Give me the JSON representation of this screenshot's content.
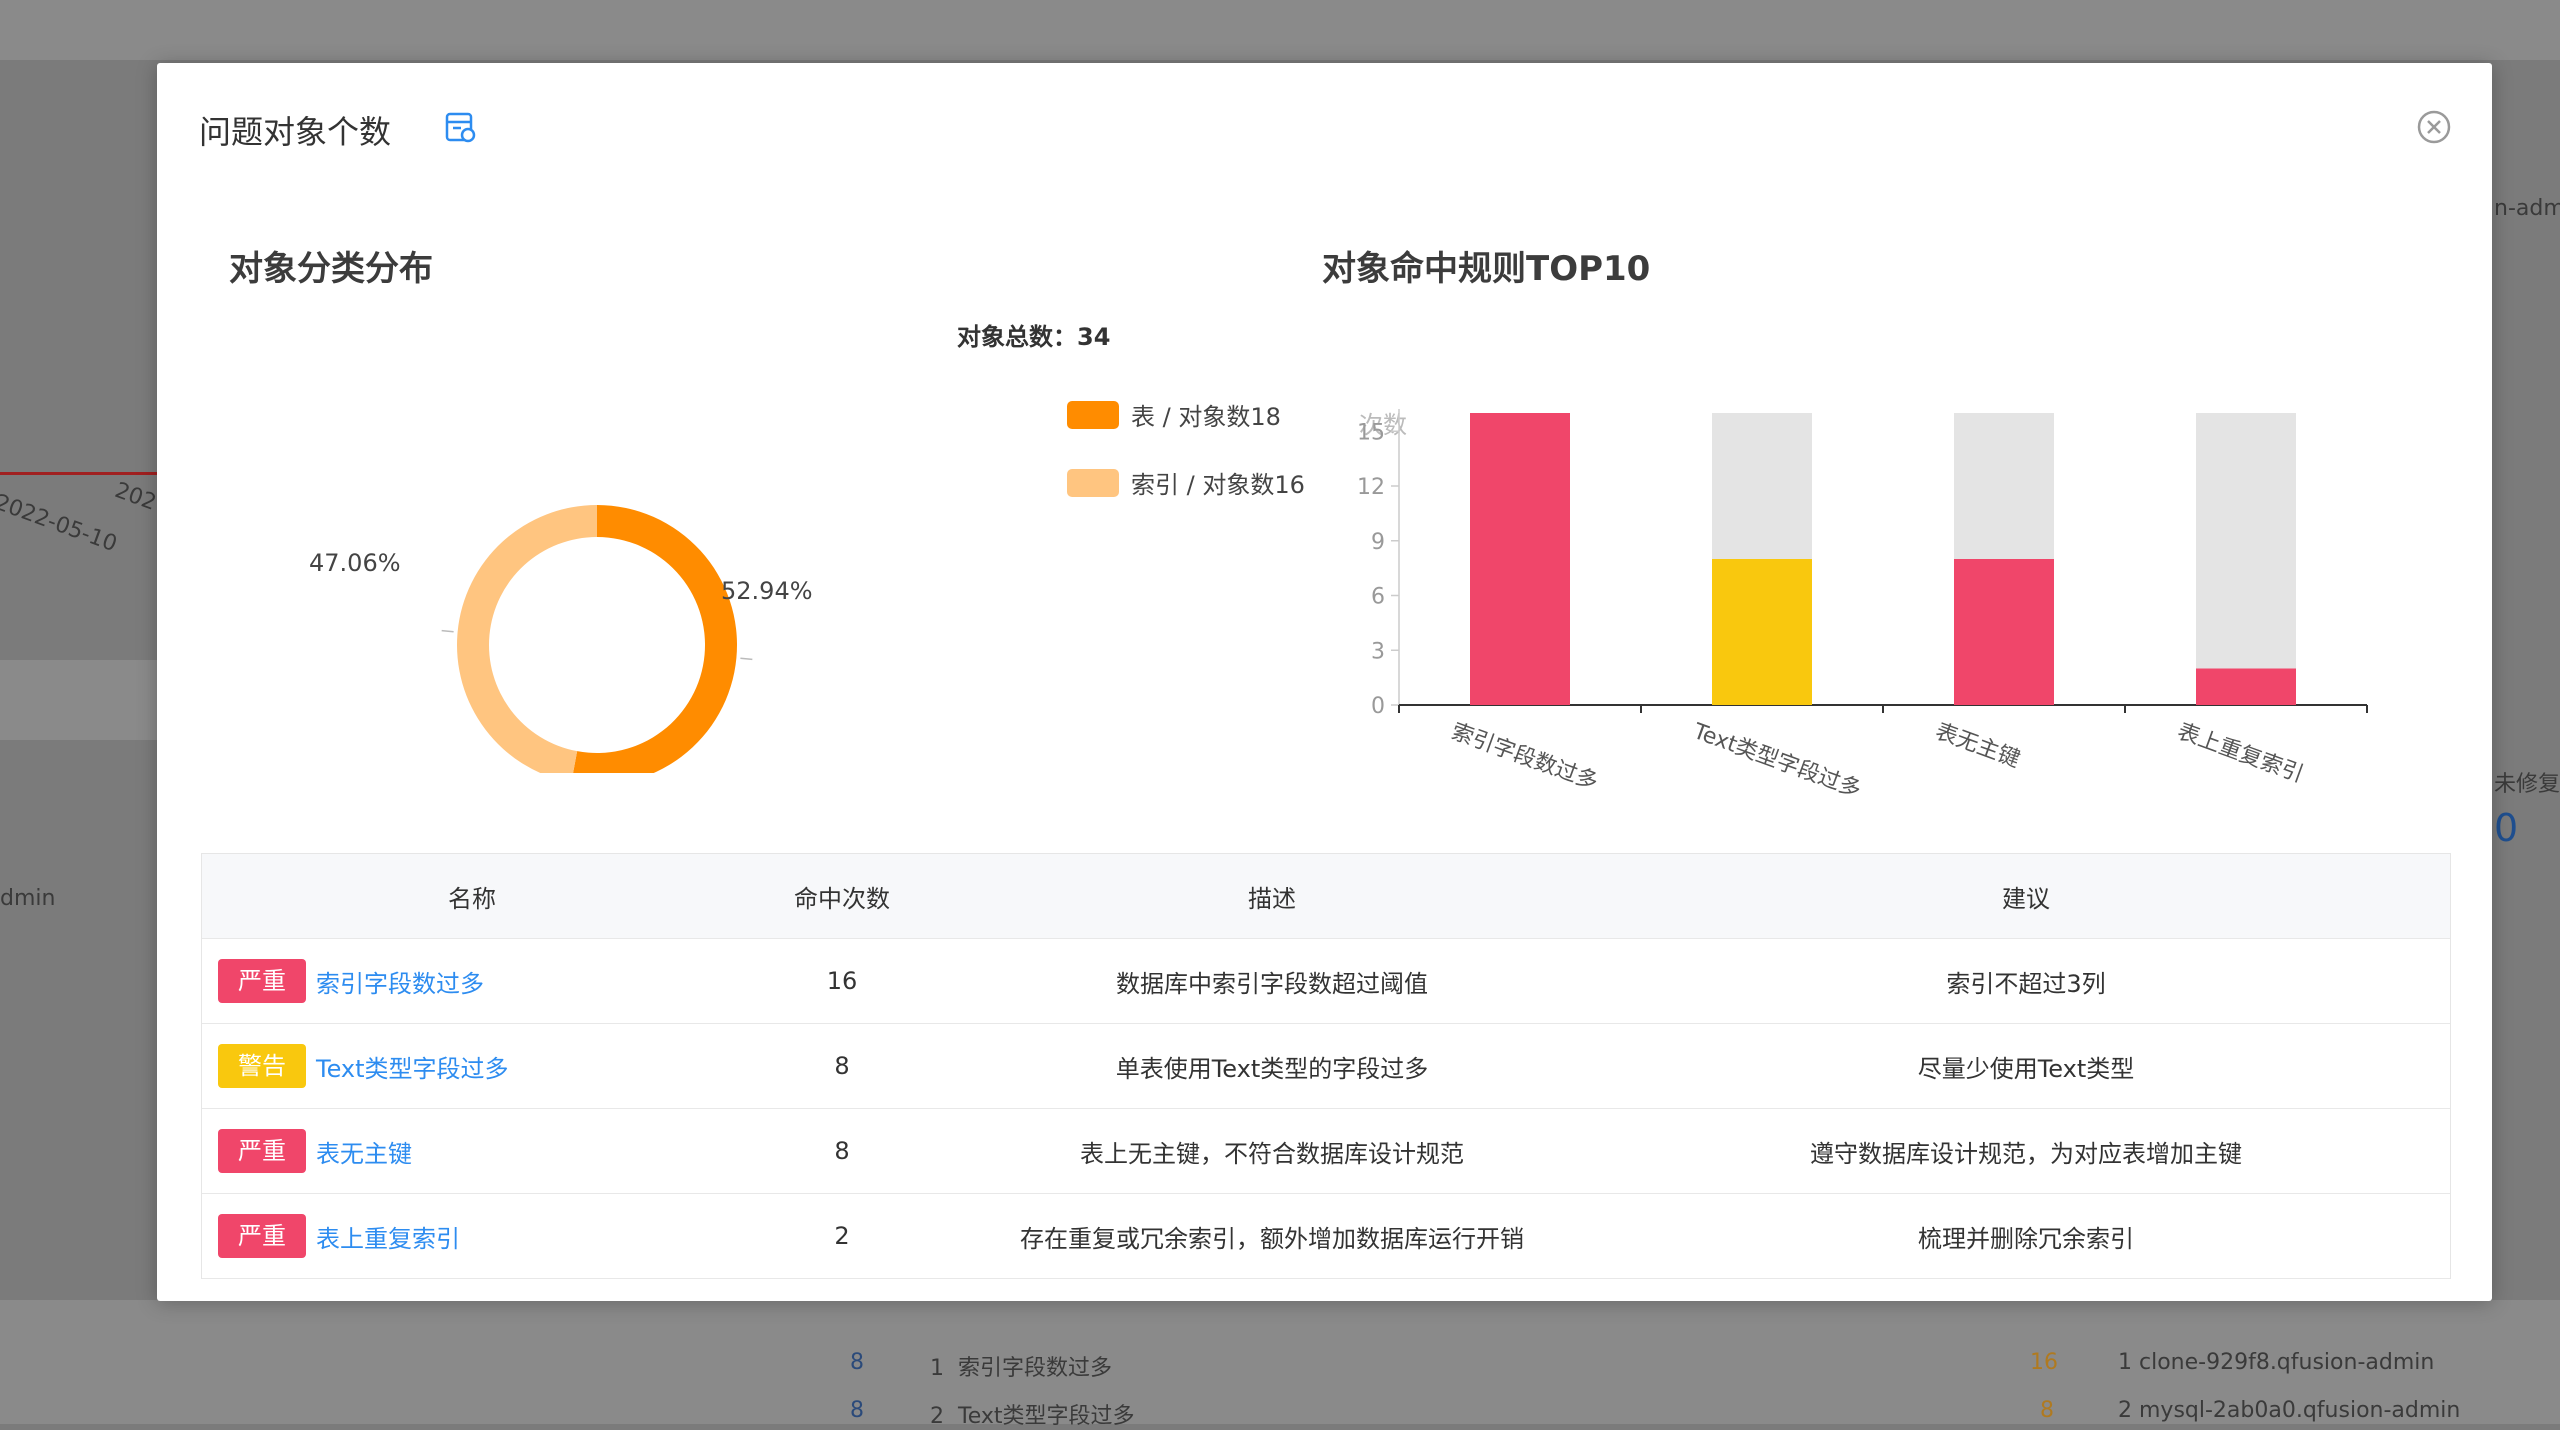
{
  "background": {
    "date_label": "2022-05-10",
    "date_label_2": "202",
    "admin_left": "dmin",
    "admin_right": "n-adm",
    "unfixed_label": "未修复",
    "unfixed_count": "0",
    "list_left": [
      {
        "rank": "1",
        "name": "索引字段数过多",
        "count": "8"
      },
      {
        "rank": "2",
        "name": "Text类型字段过多",
        "count": "8"
      }
    ],
    "list_mid_counts": [
      "16",
      "8"
    ],
    "list_right": [
      {
        "rank": "1",
        "name": "clone-929f8.qfusion-admin"
      },
      {
        "rank": "2",
        "name": "mysql-2ab0a0.qfusion-admin"
      }
    ]
  },
  "modal": {
    "title": "问题对象个数",
    "icon": "report-icon",
    "close_icon": "close-circle-icon"
  },
  "pie_section": {
    "title": "对象分类分布",
    "total_label": "对象总数：",
    "total_value": "34",
    "legend": [
      {
        "label": "表 / 对象数18",
        "color": "#ff8c00"
      },
      {
        "label": "索引 / 对象数16",
        "color": "#ffc580"
      }
    ]
  },
  "bar_section": {
    "title": "对象命中规则TOP10"
  },
  "chart_data": [
    {
      "type": "pie",
      "title": "对象分类分布",
      "categories": [
        "表",
        "索引"
      ],
      "values": [
        18,
        16
      ],
      "percent_labels": [
        "52.94%",
        "47.06%"
      ],
      "colors": [
        "#ff8c00",
        "#ffc580"
      ],
      "donut": true
    },
    {
      "type": "bar",
      "title": "对象命中规则TOP10",
      "ylabel": "次数",
      "ylim": [
        0,
        16
      ],
      "yticks": [
        0,
        3,
        6,
        9,
        12,
        15
      ],
      "categories": [
        "索引字段数过多",
        "Text类型字段过多",
        "表无主键",
        "表上重复索引"
      ],
      "values": [
        16,
        8,
        8,
        2
      ],
      "background_max": 16,
      "colors": [
        "#f0466a",
        "#f9c80e",
        "#f0466a",
        "#f0466a"
      ],
      "background_color": "#e4e4e4",
      "stacked_background": true
    }
  ],
  "table": {
    "headers": [
      "名称",
      "命中次数",
      "描述",
      "建议"
    ],
    "rows": [
      {
        "level": "严重",
        "level_color": "#f0466a",
        "name": "索引字段数过多",
        "count": "16",
        "desc": "数据库中索引字段数超过阈值",
        "advice": "索引不超过3列"
      },
      {
        "level": "警告",
        "level_color": "#f9c80e",
        "name": "Text类型字段过多",
        "count": "8",
        "desc": "单表使用Text类型的字段过多",
        "advice": "尽量少使用Text类型"
      },
      {
        "level": "严重",
        "level_color": "#f0466a",
        "name": "表无主键",
        "count": "8",
        "desc": "表上无主键，不符合数据库设计规范",
        "advice": "遵守数据库设计规范，为对应表增加主键"
      },
      {
        "level": "严重",
        "level_color": "#f0466a",
        "name": "表上重复索引",
        "count": "2",
        "desc": "存在重复或冗余索引，额外增加数据库运行开销",
        "advice": "梳理并删除冗余索引"
      }
    ]
  }
}
